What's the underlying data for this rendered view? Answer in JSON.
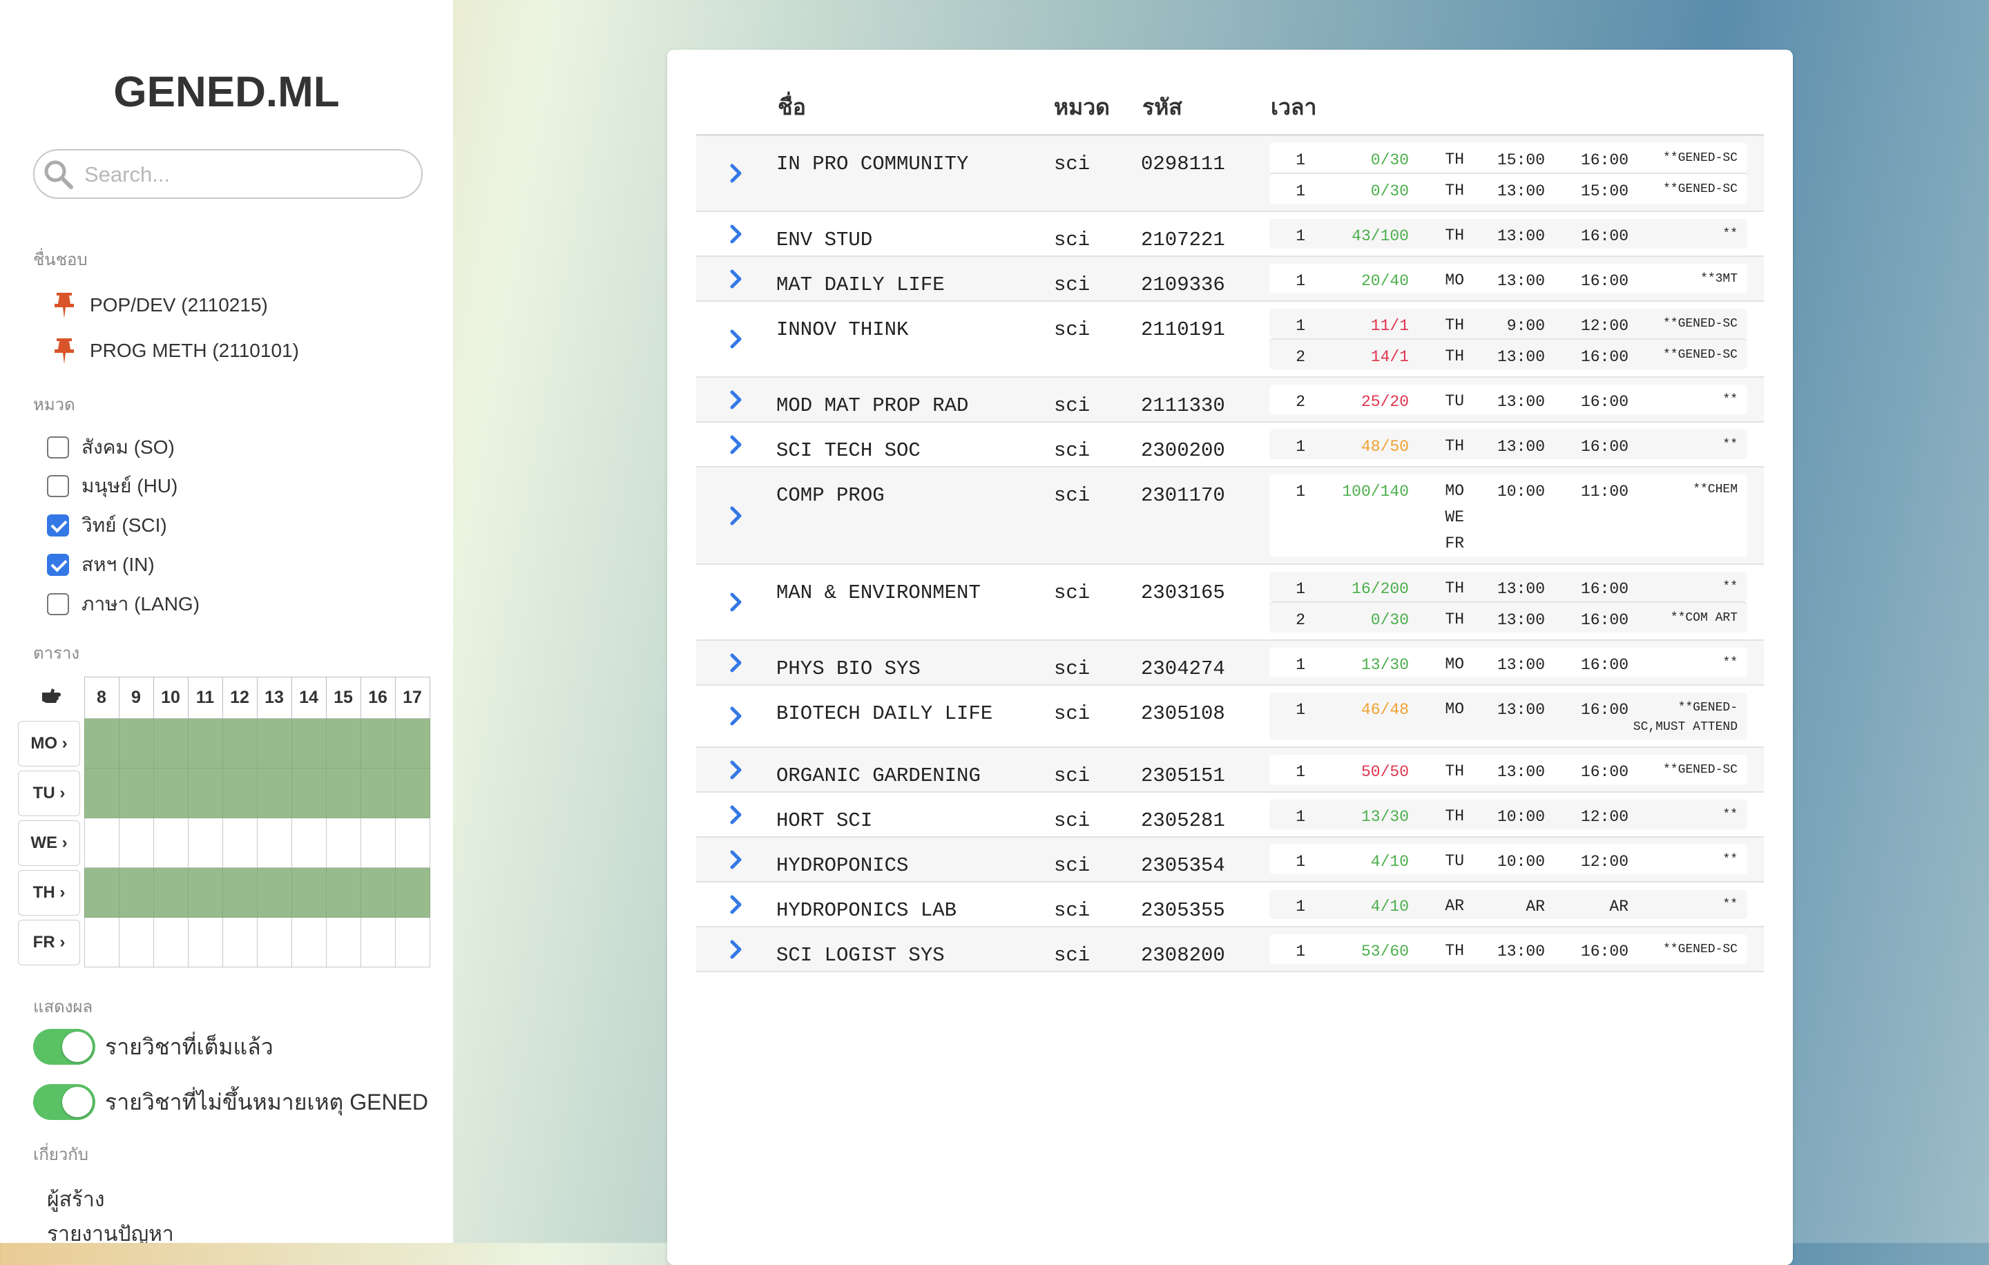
{
  "app": {
    "title": "GENED.ML"
  },
  "search": {
    "placeholder": "Search..."
  },
  "sidebar": {
    "favorites_heading": "ชื่นชอบ",
    "favorites": [
      "POP/DEV (2110215)",
      "PROG METH (2110101)"
    ],
    "categories_heading": "หมวด",
    "categories": [
      {
        "label": "สังคม (SO)",
        "checked": false
      },
      {
        "label": "มนุษย์ (HU)",
        "checked": false
      },
      {
        "label": "วิทย์ (SCI)",
        "checked": true
      },
      {
        "label": "สหฯ (IN)",
        "checked": true
      },
      {
        "label": "ภาษา (LANG)",
        "checked": false
      }
    ],
    "schedule_heading": "ตาราง",
    "schedule": {
      "hours": [
        "8",
        "9",
        "10",
        "11",
        "12",
        "13",
        "14",
        "15",
        "16",
        "17"
      ],
      "days": [
        {
          "label": "MO",
          "filled": true
        },
        {
          "label": "TU",
          "filled": true
        },
        {
          "label": "WE",
          "filled": false
        },
        {
          "label": "TH",
          "filled": true
        },
        {
          "label": "FR",
          "filled": false
        }
      ]
    },
    "display_heading": "แสดงผล",
    "toggles": [
      {
        "label": "รายวิชาที่เต็มแล้ว",
        "on": true
      },
      {
        "label": "รายวิชาที่ไม่ขึ้นหมายเหตุ GENED",
        "on": true
      }
    ],
    "about_heading": "เกี่ยวกับ",
    "about_links": [
      "ผู้สร้าง",
      "รายงานปัญหา"
    ]
  },
  "table": {
    "headers": {
      "name": "ชื่อ",
      "category": "หมวด",
      "code": "รหัส",
      "time": "เวลา"
    },
    "status_colors": {
      "available": "#4cae4c",
      "full": "#e0334e",
      "almost_full": "#f0a030"
    },
    "rows": [
      {
        "name": "IN PRO COMMUNITY",
        "category": "sci",
        "code": "0298111",
        "sections": [
          {
            "no": "1",
            "seats": "0/30",
            "status": "available",
            "days": [
              "TH"
            ],
            "start": "15:00",
            "end": "16:00",
            "note": "**GENED-SC"
          },
          {
            "no": "1",
            "seats": "0/30",
            "status": "available",
            "days": [
              "TH"
            ],
            "start": "13:00",
            "end": "15:00",
            "note": "**GENED-SC"
          }
        ]
      },
      {
        "name": "ENV STUD",
        "category": "sci",
        "code": "2107221",
        "sections": [
          {
            "no": "1",
            "seats": "43/100",
            "status": "available",
            "days": [
              "TH"
            ],
            "start": "13:00",
            "end": "16:00",
            "note": "**"
          }
        ]
      },
      {
        "name": "MAT DAILY LIFE",
        "category": "sci",
        "code": "2109336",
        "sections": [
          {
            "no": "1",
            "seats": "20/40",
            "status": "available",
            "days": [
              "MO"
            ],
            "start": "13:00",
            "end": "16:00",
            "note": "**3MT"
          }
        ]
      },
      {
        "name": "INNOV THINK",
        "category": "sci",
        "code": "2110191",
        "sections": [
          {
            "no": "1",
            "seats": "11/1",
            "status": "full",
            "days": [
              "TH"
            ],
            "start": "9:00",
            "end": "12:00",
            "note": "**GENED-SC"
          },
          {
            "no": "2",
            "seats": "14/1",
            "status": "full",
            "days": [
              "TH"
            ],
            "start": "13:00",
            "end": "16:00",
            "note": "**GENED-SC"
          }
        ]
      },
      {
        "name": "MOD MAT PROP RAD",
        "category": "sci",
        "code": "2111330",
        "sections": [
          {
            "no": "2",
            "seats": "25/20",
            "status": "full",
            "days": [
              "TU"
            ],
            "start": "13:00",
            "end": "16:00",
            "note": "**"
          }
        ]
      },
      {
        "name": "SCI TECH SOC",
        "category": "sci",
        "code": "2300200",
        "sections": [
          {
            "no": "1",
            "seats": "48/50",
            "status": "almost_full",
            "days": [
              "TH"
            ],
            "start": "13:00",
            "end": "16:00",
            "note": "**"
          }
        ]
      },
      {
        "name": "COMP PROG",
        "category": "sci",
        "code": "2301170",
        "sections": [
          {
            "no": "1",
            "seats": "100/140",
            "status": "available",
            "days": [
              "MO",
              "WE",
              "FR"
            ],
            "start": "10:00",
            "end": "11:00",
            "note": "**CHEM"
          }
        ]
      },
      {
        "name": "MAN & ENVIRONMENT",
        "category": "sci",
        "code": "2303165",
        "sections": [
          {
            "no": "1",
            "seats": "16/200",
            "status": "available",
            "days": [
              "TH"
            ],
            "start": "13:00",
            "end": "16:00",
            "note": "**"
          },
          {
            "no": "2",
            "seats": "0/30",
            "status": "available",
            "days": [
              "TH"
            ],
            "start": "13:00",
            "end": "16:00",
            "note": "**COM ART"
          }
        ]
      },
      {
        "name": "PHYS BIO SYS",
        "category": "sci",
        "code": "2304274",
        "sections": [
          {
            "no": "1",
            "seats": "13/30",
            "status": "available",
            "days": [
              "MO"
            ],
            "start": "13:00",
            "end": "16:00",
            "note": "**"
          }
        ]
      },
      {
        "name": "BIOTECH DAILY LIFE",
        "category": "sci",
        "code": "2305108",
        "sections": [
          {
            "no": "1",
            "seats": "46/48",
            "status": "almost_full",
            "days": [
              "MO"
            ],
            "start": "13:00",
            "end": "16:00",
            "note": "**GENED-SC,MUST ATTEND"
          }
        ]
      },
      {
        "name": "ORGANIC GARDENING",
        "category": "sci",
        "code": "2305151",
        "sections": [
          {
            "no": "1",
            "seats": "50/50",
            "status": "full",
            "days": [
              "TH"
            ],
            "start": "13:00",
            "end": "16:00",
            "note": "**GENED-SC"
          }
        ]
      },
      {
        "name": "HORT SCI",
        "category": "sci",
        "code": "2305281",
        "sections": [
          {
            "no": "1",
            "seats": "13/30",
            "status": "available",
            "days": [
              "TH"
            ],
            "start": "10:00",
            "end": "12:00",
            "note": "**"
          }
        ]
      },
      {
        "name": "HYDROPONICS",
        "category": "sci",
        "code": "2305354",
        "sections": [
          {
            "no": "1",
            "seats": "4/10",
            "status": "available",
            "days": [
              "TU"
            ],
            "start": "10:00",
            "end": "12:00",
            "note": "**"
          }
        ]
      },
      {
        "name": "HYDROPONICS LAB",
        "category": "sci",
        "code": "2305355",
        "sections": [
          {
            "no": "1",
            "seats": "4/10",
            "status": "available",
            "days": [
              "AR"
            ],
            "start": "AR",
            "end": "AR",
            "note": "**"
          }
        ]
      },
      {
        "name": "SCI LOGIST SYS",
        "category": "sci",
        "code": "2308200",
        "sections": [
          {
            "no": "1",
            "seats": "53/60",
            "status": "available",
            "days": [
              "TH"
            ],
            "start": "13:00",
            "end": "16:00",
            "note": "**GENED-SC"
          }
        ]
      }
    ]
  }
}
